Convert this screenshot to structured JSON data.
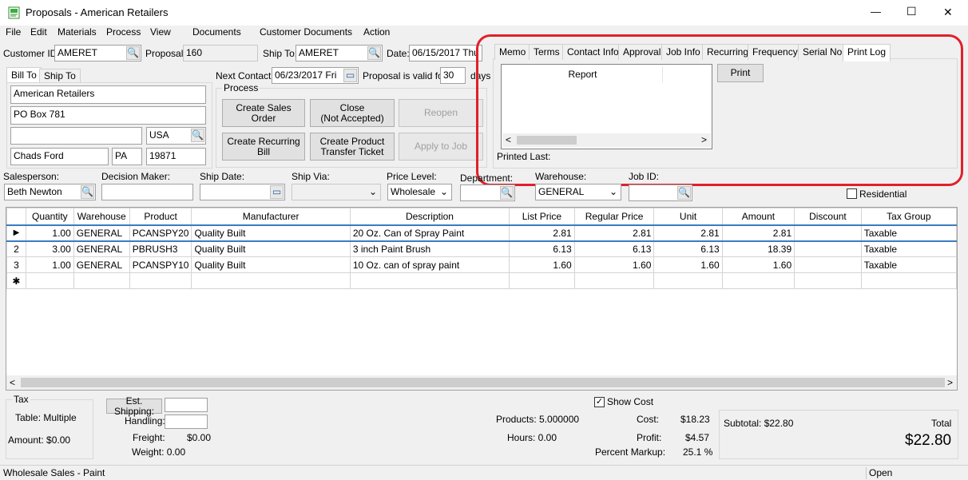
{
  "window": {
    "title": "Proposals - American Retailers",
    "minimize": "—",
    "maximize": "☐",
    "close": "✕",
    "app_icon": "document-icon"
  },
  "menu": [
    "File",
    "Edit",
    "Materials",
    "Process",
    "View",
    "Documents",
    "Customer Documents",
    "Action"
  ],
  "header": {
    "customer_id_label": "Customer ID:",
    "customer_id": "AMERET",
    "proposal_label": "Proposal:",
    "proposal": "160",
    "ship_to_label": "Ship To:",
    "ship_to": "AMERET",
    "date_label": "Date:",
    "date": "06/15/2017 Thu",
    "next_contact_label": "Next Contact:",
    "next_contact": "06/23/2017 Fri",
    "valid_for_label": "Proposal is valid for",
    "valid_for": "30",
    "days_label": "days"
  },
  "address": {
    "tab_bill_to": "Bill To",
    "tab_ship_to": "Ship To",
    "name": "American Retailers",
    "line1": "PO Box 781",
    "line2": "",
    "country": "USA",
    "city": "Chads Ford",
    "state": "PA",
    "zip": "19871"
  },
  "process": {
    "group_label": "Process",
    "create_sales_order": "Create Sales Order",
    "close_line1": "Close",
    "close_line2": "(Not Accepted)",
    "reopen": "Reopen",
    "create_recurring_bill": "Create Recurring Bill",
    "create_transfer_line1": "Create Product",
    "create_transfer_line2": "Transfer Ticket",
    "apply_to_job": "Apply to Job"
  },
  "tabs": [
    "Memo",
    "Terms",
    "Contact Info",
    "Approval",
    "Job Info",
    "Recurring",
    "Frequency",
    "Serial No.",
    "Print Log"
  ],
  "print_log": {
    "report_header": "Report",
    "print_button": "Print",
    "printed_last_label": "Printed Last:"
  },
  "details": {
    "salesperson_label": "Salesperson:",
    "salesperson": "Beth Newton",
    "decision_maker_label": "Decision Maker:",
    "decision_maker": "",
    "ship_date_label": "Ship Date:",
    "ship_date": "",
    "ship_via_label": "Ship Via:",
    "ship_via": "",
    "price_level_label": "Price Level:",
    "price_level": "Wholesale",
    "department_label": "Department:",
    "department": "",
    "warehouse_label": "Warehouse:",
    "warehouse": "GENERAL",
    "job_id_label": "Job ID:",
    "job_id": "",
    "residential_label": "Residential"
  },
  "grid": {
    "columns": [
      "Quantity",
      "Warehouse",
      "Product",
      "Manufacturer",
      "Description",
      "List Price",
      "Regular Price",
      "Unit",
      "Amount",
      "Discount",
      "Tax Group"
    ],
    "rows": [
      {
        "marker": "▶",
        "quantity": "1.00",
        "warehouse": "GENERAL",
        "product": "PCANSPY20",
        "manufacturer": "Quality Built",
        "description": "20 Oz. Can of Spray Paint",
        "list_price": "2.81",
        "regular_price": "2.81",
        "unit": "2.81",
        "amount": "2.81",
        "discount": "",
        "tax_group": "Taxable"
      },
      {
        "marker": "2",
        "quantity": "3.00",
        "warehouse": "GENERAL",
        "product": "PBRUSH3",
        "manufacturer": "Quality Built",
        "description": "3 inch Paint Brush",
        "list_price": "6.13",
        "regular_price": "6.13",
        "unit": "6.13",
        "amount": "18.39",
        "discount": "",
        "tax_group": "Taxable"
      },
      {
        "marker": "3",
        "quantity": "1.00",
        "warehouse": "GENERAL",
        "product": "PCANSPY10",
        "manufacturer": "Quality Built",
        "description": "10 Oz. can of spray paint",
        "list_price": "1.60",
        "regular_price": "1.60",
        "unit": "1.60",
        "amount": "1.60",
        "discount": "",
        "tax_group": "Taxable"
      }
    ],
    "new_row_marker": "✱"
  },
  "footer": {
    "tax_group_label": "Tax",
    "tax_table": "Table: Multiple",
    "tax_amount": "Amount: $0.00",
    "est_shipping": "Est. Shipping:",
    "handling_label": "Handling:",
    "freight_label": "Freight:",
    "freight_value": "$0.00",
    "weight": "Weight: 0.00",
    "show_cost_label": "Show Cost",
    "products": "Products: 5.000000",
    "hours": "Hours: 0.00",
    "cost_label": "Cost:",
    "cost_value": "$18.23",
    "profit_label": "Profit:",
    "profit_value": "$4.57",
    "markup_label": "Percent Markup:",
    "markup_value": "25.1 %",
    "subtotal": "Subtotal: $22.80",
    "total_label": "Total",
    "total_value": "$22.80"
  },
  "status": {
    "left": "Wholesale Sales - Paint",
    "right": "Open"
  },
  "colors": {
    "highlight": "#e0202a",
    "selection": "#3b7bbf"
  }
}
